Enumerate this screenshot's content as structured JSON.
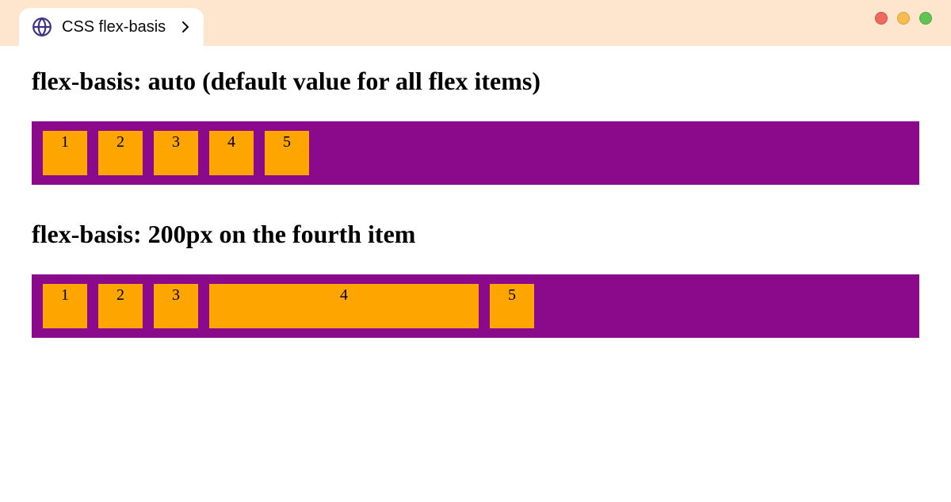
{
  "tab": {
    "title": "CSS flex-basis"
  },
  "sections": [
    {
      "heading": "flex-basis: auto (default value for all flex items)",
      "items": [
        "1",
        "2",
        "3",
        "4",
        "5"
      ],
      "wide_index": null
    },
    {
      "heading": "flex-basis: 200px on the fourth item",
      "items": [
        "1",
        "2",
        "3",
        "4",
        "5"
      ],
      "wide_index": 3
    }
  ]
}
